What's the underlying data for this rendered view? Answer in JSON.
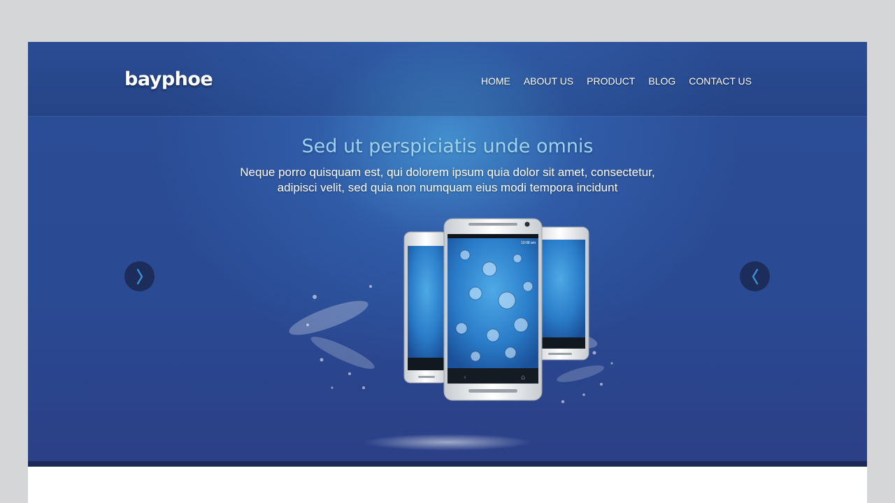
{
  "brand": {
    "logo_text": "bayphoe"
  },
  "nav": {
    "items": [
      {
        "label": "HOME"
      },
      {
        "label": "ABOUT US"
      },
      {
        "label": "PRODUCT"
      },
      {
        "label": "BLOG"
      },
      {
        "label": "CONTACT US"
      }
    ]
  },
  "hero": {
    "headline": "Sed ut perspiciatis unde omnis",
    "subtext_line1": "Neque porro quisquam est, qui dolorem ipsum quia dolor sit amet, consectetur,",
    "subtext_line2": "adipisci velit, sed quia non numquam eius modi tempora incidunt",
    "phone_time": "10:08 am",
    "prev_icon": "chevron-right-icon",
    "next_icon": "chevron-left-icon"
  },
  "colors": {
    "background": "#d4d6d8",
    "hero_dark": "#2a4a93",
    "hero_glow": "#4aa5e1",
    "headline": "#9cd2f2",
    "arrow_bg": "#1c2d5c",
    "arrow_glyph": "#3d8fd1",
    "bottom_bar": "#1c2a57"
  }
}
